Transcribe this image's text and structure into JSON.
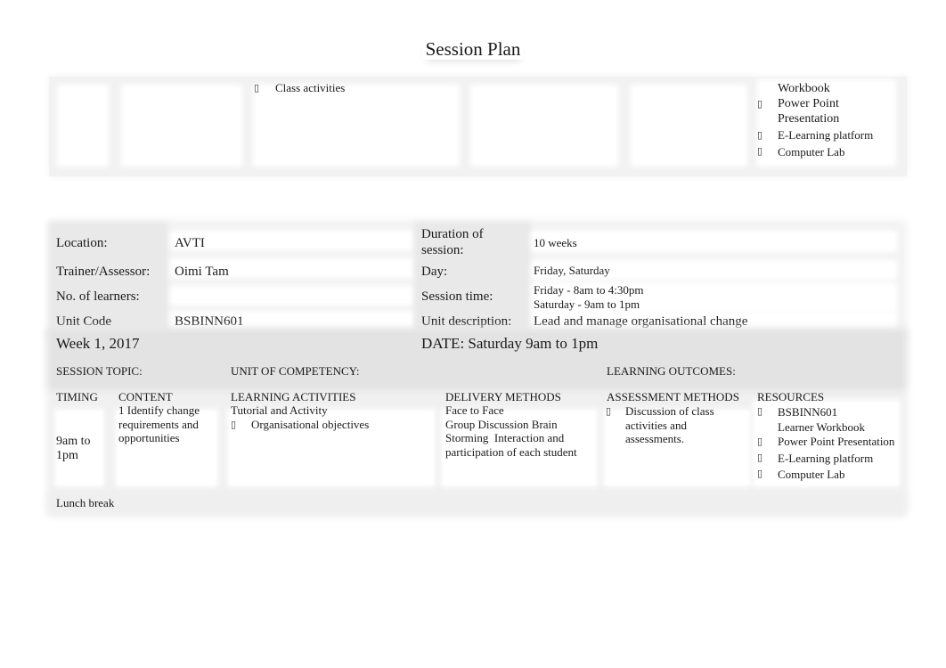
{
  "title": "Session Plan",
  "top_fragment": {
    "activities": [
      "Class activities"
    ],
    "resources": {
      "continued_line": "Workbook",
      "items": [
        "Power Point Presentation",
        "E-Learning platform",
        "Computer Lab"
      ]
    },
    "bullet_icon": "checkbox-bullet-icon"
  },
  "info": {
    "location_label": "Location:",
    "location_value": "AVTI",
    "trainer_label": "Trainer/Assessor:",
    "trainer_value": "Oimi Tam",
    "learners_label": "No. of learners:",
    "learners_value": "",
    "unit_code_label": "Unit Code",
    "unit_code_value": "BSBINN601",
    "duration_label": "Duration of session:",
    "duration_value": "10 weeks",
    "day_label": "Day:",
    "day_value": "Friday, Saturday",
    "session_time_label": "Session time:",
    "session_time_lines": [
      "Friday - 8am to 4:30pm",
      "Saturday - 9am to 1pm"
    ],
    "unit_desc_label": "Unit description:",
    "unit_desc_value": "Lead and manage organisational change"
  },
  "week": {
    "week_label": "Week 1, 2017",
    "date_label": "DATE: Saturday 9am to 1pm",
    "session_topic_label": "SESSION TOPIC:",
    "unit_competency_label": "UNIT OF COMPETENCY:",
    "learning_outcomes_label": "LEARNING OUTCOMES:",
    "columns": [
      "TIMING",
      "CONTENT",
      "LEARNING ACTIVITIES",
      "DELIVERY METHODS",
      "ASSESSMENT METHODS",
      "RESOURCES"
    ],
    "row": {
      "timing": "9am to 1pm",
      "content": "1 Identify change requirements and opportunities",
      "learning_activities_intro": "Tutorial and Activity",
      "learning_activities": [
        "Organisational objectives"
      ],
      "delivery_methods": [
        "Face to Face",
        "Group Discussion Brain Storming  Interaction and participation of each student"
      ],
      "assessment_methods": [
        "Discussion of class activities and assessments."
      ],
      "resources": [
        "BSBINN601 Learner Workbook",
        "Power Point Presentation",
        "E-Learning platform",
        "Computer Lab"
      ]
    },
    "lunch_break": "Lunch break"
  }
}
